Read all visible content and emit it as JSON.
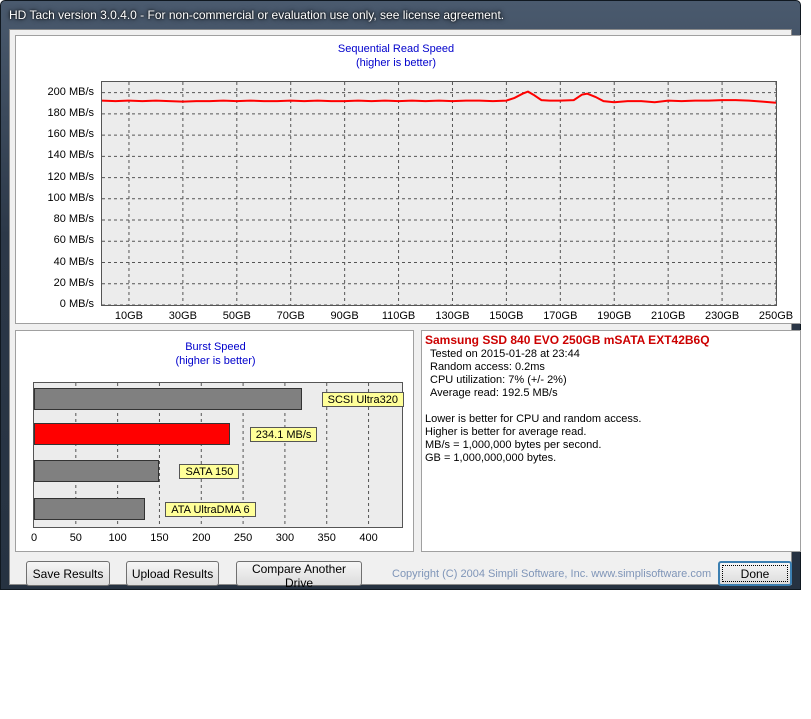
{
  "window": {
    "title": "HD Tach version 3.0.4.0  - For non-commercial or evaluation use only, see license agreement."
  },
  "sequential": {
    "title": "Sequential Read Speed",
    "subtitle": "(higher is better)"
  },
  "burst": {
    "title": "Burst Speed",
    "subtitle": "(higher is better)"
  },
  "info": {
    "drive_name": "Samsung SSD 840 EVO 250GB mSATA EXT42B6Q",
    "tested_on": "Tested on 2015-01-28 at 23:44",
    "random_access": "Random access: 0.2ms",
    "cpu_utilization": "CPU utilization: 7% (+/- 2%)",
    "average_read": "Average read: 192.5 MB/s",
    "note1": "Lower is better for CPU and random access.",
    "note2": "Higher is better for average read.",
    "note3": "MB/s = 1,000,000 bytes per second.",
    "note4": "GB = 1,000,000,000 bytes.",
    "drive_name_color": "#cc0000"
  },
  "buttons": {
    "save": "Save Results",
    "upload": "Upload Results",
    "compare": "Compare Another Drive",
    "done": "Done"
  },
  "copyright": "Copyright (C) 2004 Simpli Software, Inc. www.simplisoftware.com",
  "chart_data": [
    {
      "type": "line",
      "title": "Sequential Read Speed",
      "subtitle": "(higher is better)",
      "xlabel": "",
      "ylabel": "",
      "xlim": [
        0,
        250
      ],
      "ylim": [
        0,
        210
      ],
      "y_ticks": [
        0,
        20,
        40,
        60,
        80,
        100,
        120,
        140,
        160,
        180,
        200
      ],
      "y_tick_labels": [
        "0 MB/s",
        "20 MB/s",
        "40 MB/s",
        "60 MB/s",
        "80 MB/s",
        "100 MB/s",
        "120 MB/s",
        "140 MB/s",
        "160 MB/s",
        "180 MB/s",
        "200 MB/s"
      ],
      "x_ticks": [
        10,
        30,
        50,
        70,
        90,
        110,
        130,
        150,
        170,
        190,
        210,
        230,
        250
      ],
      "x_tick_labels": [
        "10GB",
        "30GB",
        "50GB",
        "70GB",
        "90GB",
        "110GB",
        "130GB",
        "150GB",
        "170GB",
        "190GB",
        "210GB",
        "230GB",
        "250GB"
      ],
      "grid": true,
      "line_color": "#ff0000",
      "series": [
        {
          "x": [
            0,
            5,
            10,
            15,
            20,
            25,
            30,
            35,
            40,
            45,
            50,
            55,
            60,
            65,
            70,
            75,
            80,
            85,
            90,
            95,
            100,
            105,
            110,
            115,
            120,
            125,
            130,
            135,
            140,
            145,
            150,
            153,
            156,
            158,
            160,
            163,
            166,
            170,
            175,
            178,
            180,
            183,
            186,
            190,
            195,
            200,
            205,
            210,
            215,
            220,
            225,
            230,
            235,
            240,
            245,
            250
          ],
          "y": [
            192.5,
            192,
            192.5,
            192,
            192.5,
            192,
            191.5,
            192,
            192,
            192.5,
            192,
            192.5,
            192,
            192,
            192.5,
            192,
            192.5,
            192,
            192,
            192.5,
            192,
            192.5,
            192,
            192.5,
            192,
            192.5,
            192,
            192.5,
            192.5,
            192,
            192.5,
            195,
            199,
            201,
            198,
            193,
            192.5,
            192.5,
            193,
            198,
            199,
            196,
            192,
            191,
            192,
            192,
            191,
            192.5,
            192,
            192.5,
            192.5,
            193,
            193,
            192.5,
            191.5,
            190.5
          ]
        }
      ]
    },
    {
      "type": "bar",
      "orientation": "horizontal",
      "title": "Burst Speed",
      "subtitle": "(higher is better)",
      "xlim": [
        0,
        440
      ],
      "x_ticks": [
        0,
        50,
        100,
        150,
        200,
        250,
        300,
        350,
        400
      ],
      "grid": true,
      "categories": [
        "SCSI Ultra320",
        "234.1 MB/s",
        "SATA 150",
        "ATA UltraDMA 6"
      ],
      "values": [
        320,
        234.1,
        150,
        133
      ],
      "colors": [
        "#808080",
        "#ff0000",
        "#808080",
        "#808080"
      ]
    }
  ]
}
